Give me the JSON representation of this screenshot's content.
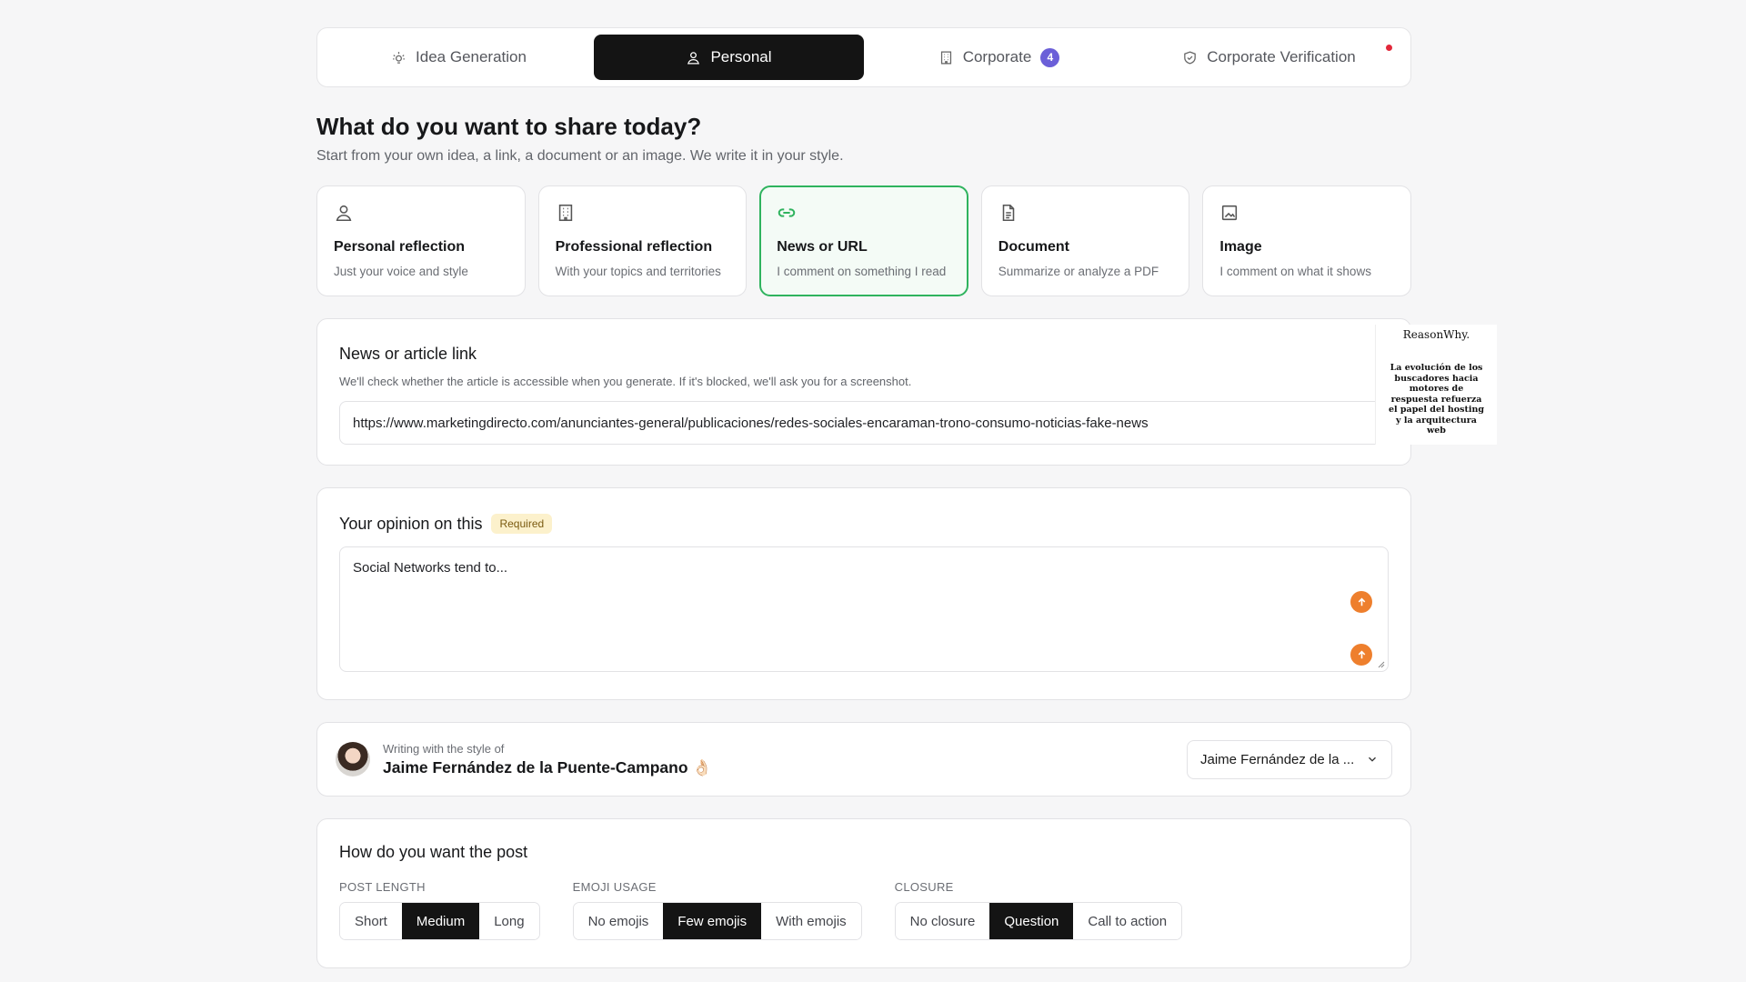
{
  "tabs": [
    {
      "label": "Idea Generation",
      "icon": "lightbulb-icon"
    },
    {
      "label": "Personal",
      "icon": "user-icon",
      "active": true
    },
    {
      "label": "Corporate",
      "icon": "building-icon",
      "badge": "4"
    },
    {
      "label": "Corporate Verification",
      "icon": "shield-check-icon"
    }
  ],
  "header": {
    "title": "What do you want to share today?",
    "subtitle": "Start from your own idea, a link, a document or an image. We write it in your style."
  },
  "sources": [
    {
      "title": "Personal reflection",
      "desc": "Just your voice and style",
      "icon": "user-icon"
    },
    {
      "title": "Professional reflection",
      "desc": "With your topics and territories",
      "icon": "building-icon"
    },
    {
      "title": "News or URL",
      "desc": "I comment on something I read",
      "icon": "link-icon",
      "active": true
    },
    {
      "title": "Document",
      "desc": "Summarize or analyze a PDF",
      "icon": "document-icon"
    },
    {
      "title": "Image",
      "desc": "I comment on what it shows",
      "icon": "image-icon"
    }
  ],
  "link": {
    "title": "News or article link",
    "help": "We'll check whether the article is accessible when you generate. If it's blocked, we'll ask you for a screenshot.",
    "url": "https://www.marketingdirecto.com/anunciantes-general/publicaciones/redes-sociales-encaraman-trono-consumo-noticias-fake-news"
  },
  "thumbnail": {
    "logo": "ReasonWhy.",
    "text": "La evolución de los buscadores hacia motores de respuesta refuerza el papel del hosting y la arquitectura web"
  },
  "opinion": {
    "title": "Your opinion on this",
    "required": "Required",
    "value": "Social Networks tend to..."
  },
  "style": {
    "label": "Writing with the style of",
    "name": "Jaime Fernández de la Puente-Campano",
    "emoji": "👌🏻",
    "select": "Jaime Fernández de la ..."
  },
  "post": {
    "title": "How do you want the post",
    "groups": [
      {
        "label": "POST LENGTH",
        "options": [
          "Short",
          "Medium",
          "Long"
        ],
        "selected": "Medium"
      },
      {
        "label": "EMOJI USAGE",
        "options": [
          "No emojis",
          "Few emojis",
          "With emojis"
        ],
        "selected": "Few emojis"
      },
      {
        "label": "CLOSURE",
        "options": [
          "No closure",
          "Question",
          "Call to action"
        ],
        "selected": "Question"
      }
    ]
  },
  "colors": {
    "accent_green": "#2fb35e",
    "badge_purple": "#6b5fd8",
    "action_orange": "#ee7f2d",
    "dark": "#141414"
  }
}
